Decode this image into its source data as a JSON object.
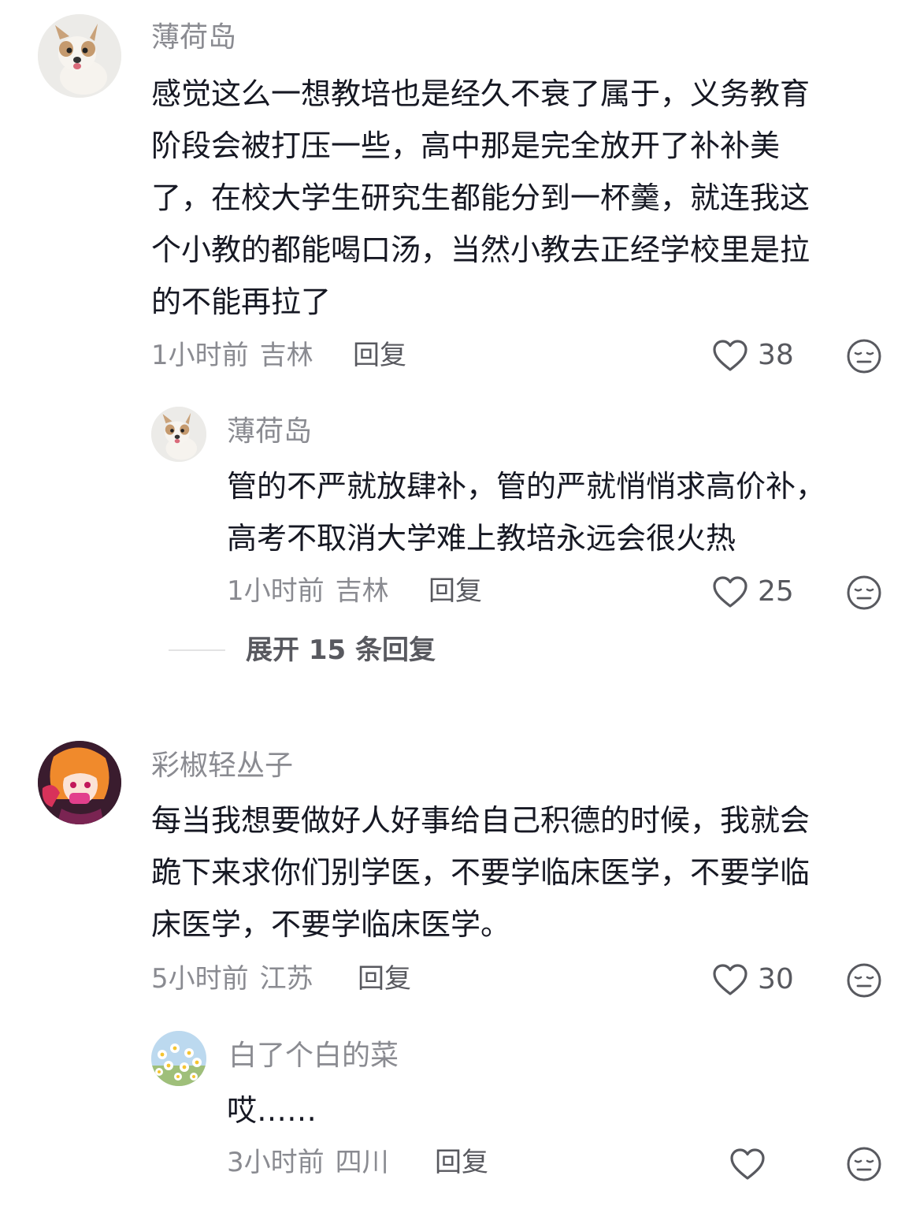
{
  "comments": [
    {
      "username": "薄荷岛",
      "avatar": "chihuahua-dog-photo",
      "lines": [
        "感觉这么一想教培也是经久不衰了属于，义务教育",
        "阶段会被打压一些，高中那是完全放开了补补美",
        "了，在校大学生研究生都能分到一杯羹，就连我这",
        "个小教的都能喝口汤，当然小教去正经学校里是拉",
        "的不能再拉了"
      ],
      "time": "1小时前",
      "location": "吉林",
      "reply_label": "回复",
      "likes": "38",
      "replies": [
        {
          "username": "薄荷岛",
          "avatar": "chihuahua-dog-photo",
          "lines": [
            "管的不严就放肆补，管的严就悄悄求高价补，",
            "高考不取消大学难上教培永远会很火热"
          ],
          "time": "1小时前",
          "location": "吉林",
          "reply_label": "回复",
          "likes": "25"
        }
      ],
      "expand_label": "展开 15 条回复"
    },
    {
      "username": "彩椒轻丛子",
      "avatar": "anime-girl-illustration",
      "lines": [
        "每当我想要做好人好事给自己积德的时候，我就会",
        "跪下来求你们别学医，不要学临床医学，不要学临",
        "床医学，不要学临床医学。"
      ],
      "time": "5小时前",
      "location": "江苏",
      "reply_label": "回复",
      "likes": "30",
      "replies": [
        {
          "username": "白了个白的菜",
          "avatar": "daisy-flowers-photo",
          "lines": [
            "哎……"
          ],
          "time": "3小时前",
          "location": "四川",
          "reply_label": "回复",
          "likes": ""
        }
      ]
    }
  ],
  "icons": {
    "like": "heart-outline-icon",
    "dislike": "meh-face-icon"
  },
  "colors": {
    "text_primary": "#161823",
    "text_secondary": "#8a8b91",
    "action_text": "#58595f"
  }
}
